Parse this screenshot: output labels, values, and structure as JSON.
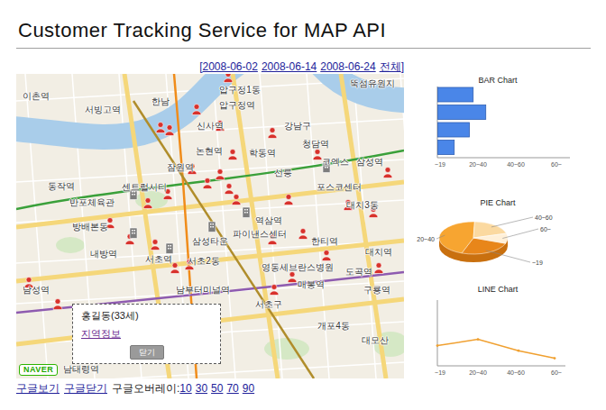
{
  "page": {
    "title": "Customer Tracking Service for MAP API"
  },
  "date_links": {
    "open": "[",
    "close": "]",
    "items": [
      {
        "label": "2008-06-02"
      },
      {
        "label": "2008-06-14"
      },
      {
        "label": "2008-06-24"
      },
      {
        "label": "전체"
      }
    ]
  },
  "map": {
    "labels": [
      "압구정1동",
      "뚝섬유원지",
      "이촌역",
      "서빙고역",
      "한남",
      "압구정역",
      "신사역",
      "강남구",
      "청담역",
      "잠원역",
      "논현역",
      "학동역",
      "코엑스",
      "삼성역",
      "선릉",
      "동작역",
      "센트럴시티",
      "포스코센터",
      "반포체육관",
      "대치3동",
      "방배본동",
      "삼성타운",
      "역삼역",
      "파이낸스센터",
      "한티역",
      "대치역",
      "내방역",
      "서초역",
      "서초2동",
      "영동세브란스병원",
      "도곡역",
      "매봉역",
      "구룡역",
      "남성역",
      "남부터미널역",
      "서초구",
      "개포4동",
      "대모산",
      "남태령역"
    ],
    "markers": [
      {
        "kind": "customer"
      },
      {
        "kind": "customer"
      },
      {
        "kind": "customer"
      },
      {
        "kind": "customer"
      },
      {
        "kind": "customer"
      },
      {
        "kind": "customer"
      },
      {
        "kind": "customer"
      },
      {
        "kind": "customer"
      },
      {
        "kind": "customer"
      },
      {
        "kind": "customer"
      },
      {
        "kind": "customer"
      },
      {
        "kind": "customer"
      },
      {
        "kind": "customer"
      },
      {
        "kind": "customer"
      },
      {
        "kind": "customer"
      },
      {
        "kind": "customer"
      },
      {
        "kind": "customer"
      },
      {
        "kind": "customer"
      },
      {
        "kind": "customer"
      },
      {
        "kind": "customer"
      },
      {
        "kind": "customer"
      },
      {
        "kind": "customer"
      },
      {
        "kind": "customer"
      },
      {
        "kind": "customer"
      },
      {
        "kind": "customer"
      },
      {
        "kind": "customer"
      },
      {
        "kind": "customer"
      },
      {
        "kind": "customer"
      },
      {
        "kind": "customer"
      },
      {
        "kind": "customer"
      },
      {
        "kind": "customer"
      },
      {
        "kind": "customer"
      },
      {
        "kind": "building"
      },
      {
        "kind": "building"
      },
      {
        "kind": "building"
      },
      {
        "kind": "building"
      },
      {
        "kind": "building"
      },
      {
        "kind": "building"
      }
    ],
    "logo": "NAVER",
    "popup": {
      "name": "홍길동(33세)",
      "link": "지역정보",
      "button": "닫기"
    }
  },
  "map_controls": {
    "links": [
      "구글보기",
      "구글닫기"
    ],
    "overlay_label": "구글오버레이:",
    "overlay_levels": [
      "10",
      "30",
      "50",
      "70",
      "90"
    ]
  },
  "charts": {
    "bar": {
      "title": "BAR Chart",
      "ticks": [
        "~19",
        "20~40",
        "40~60",
        "60~"
      ],
      "values": [
        28,
        38,
        25,
        13
      ]
    },
    "pie": {
      "title": "PIE Chart",
      "slices": [
        {
          "label": "~19",
          "value": 25,
          "color": "#e8861a"
        },
        {
          "label": "20~40",
          "value": 45,
          "color": "#f7a531"
        },
        {
          "label": "40~60",
          "value": 20,
          "color": "#fbd9a0"
        },
        {
          "label": "60~",
          "value": 10,
          "color": "#fff0d8"
        }
      ]
    },
    "line": {
      "title": "LINE Chart",
      "ticks": [
        "~19",
        "20~40",
        "40~60",
        "60~"
      ],
      "values": [
        16,
        21,
        12,
        6
      ]
    }
  }
}
